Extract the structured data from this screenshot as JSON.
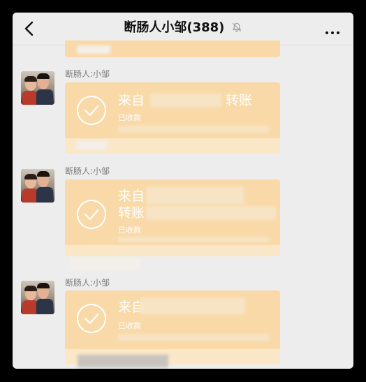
{
  "header": {
    "title": "断肠人小邹(388)",
    "back_icon": "back-chevron-icon",
    "mute_icon": "mute-bell-icon",
    "more_icon": "more-dots-icon"
  },
  "messages": [
    {
      "sender": "断肠人:小邹",
      "card": {
        "line1": "来自",
        "line1_suffix": "转账",
        "status": "已收款",
        "icon": "check-circle-icon"
      }
    },
    {
      "sender": "断肠人:小邹",
      "card": {
        "line1": "来自",
        "line2": "转账",
        "status": "已收款",
        "icon": "check-circle-icon"
      }
    },
    {
      "sender": "断肠人:小邹",
      "card": {
        "line1": "来自",
        "status": "已收款",
        "icon": "check-circle-icon"
      }
    }
  ],
  "colors": {
    "card": "#f9d9a8",
    "background": "#ededed"
  }
}
